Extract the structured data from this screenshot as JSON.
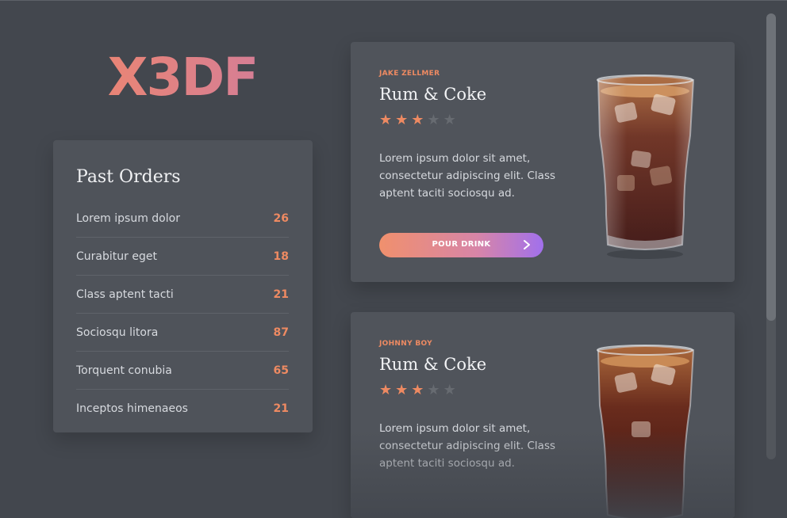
{
  "app": {
    "logo_text": "X3DF"
  },
  "past_orders": {
    "title": "Past Orders",
    "items": [
      {
        "name": "Lorem ipsum dolor",
        "count": "26"
      },
      {
        "name": "Curabitur eget",
        "count": "18"
      },
      {
        "name": "Class aptent tacti",
        "count": "21"
      },
      {
        "name": "Sociosqu litora",
        "count": "87"
      },
      {
        "name": "Torquent conubia",
        "count": "65"
      },
      {
        "name": "Inceptos himenaeos",
        "count": "21"
      }
    ]
  },
  "drinks": [
    {
      "author": "JAKE ZELLMER",
      "name": "Rum & Coke",
      "rating": 3,
      "rating_max": 5,
      "description": "Lorem ipsum dolor sit amet, consectetur adipiscing elit. Class aptent taciti sociosqu ad.",
      "button_label": "POUR DRINK"
    },
    {
      "author": "JOHNNY BOY",
      "name": "Rum & Coke",
      "rating": 3,
      "rating_max": 5,
      "description": "Lorem ipsum dolor sit amet, consectetur adipiscing elit. Class aptent taciti sociosqu ad."
    }
  ],
  "colors": {
    "background": "#43474e",
    "panel": "#4f535a",
    "accent": "#ee8a62",
    "button_gradient_start": "#f0906d",
    "button_gradient_end": "#a170ec"
  },
  "icons": {
    "star": "star-icon",
    "chevron": "chevron-right-icon",
    "drink_image": "glass-of-rum-and-coke"
  }
}
